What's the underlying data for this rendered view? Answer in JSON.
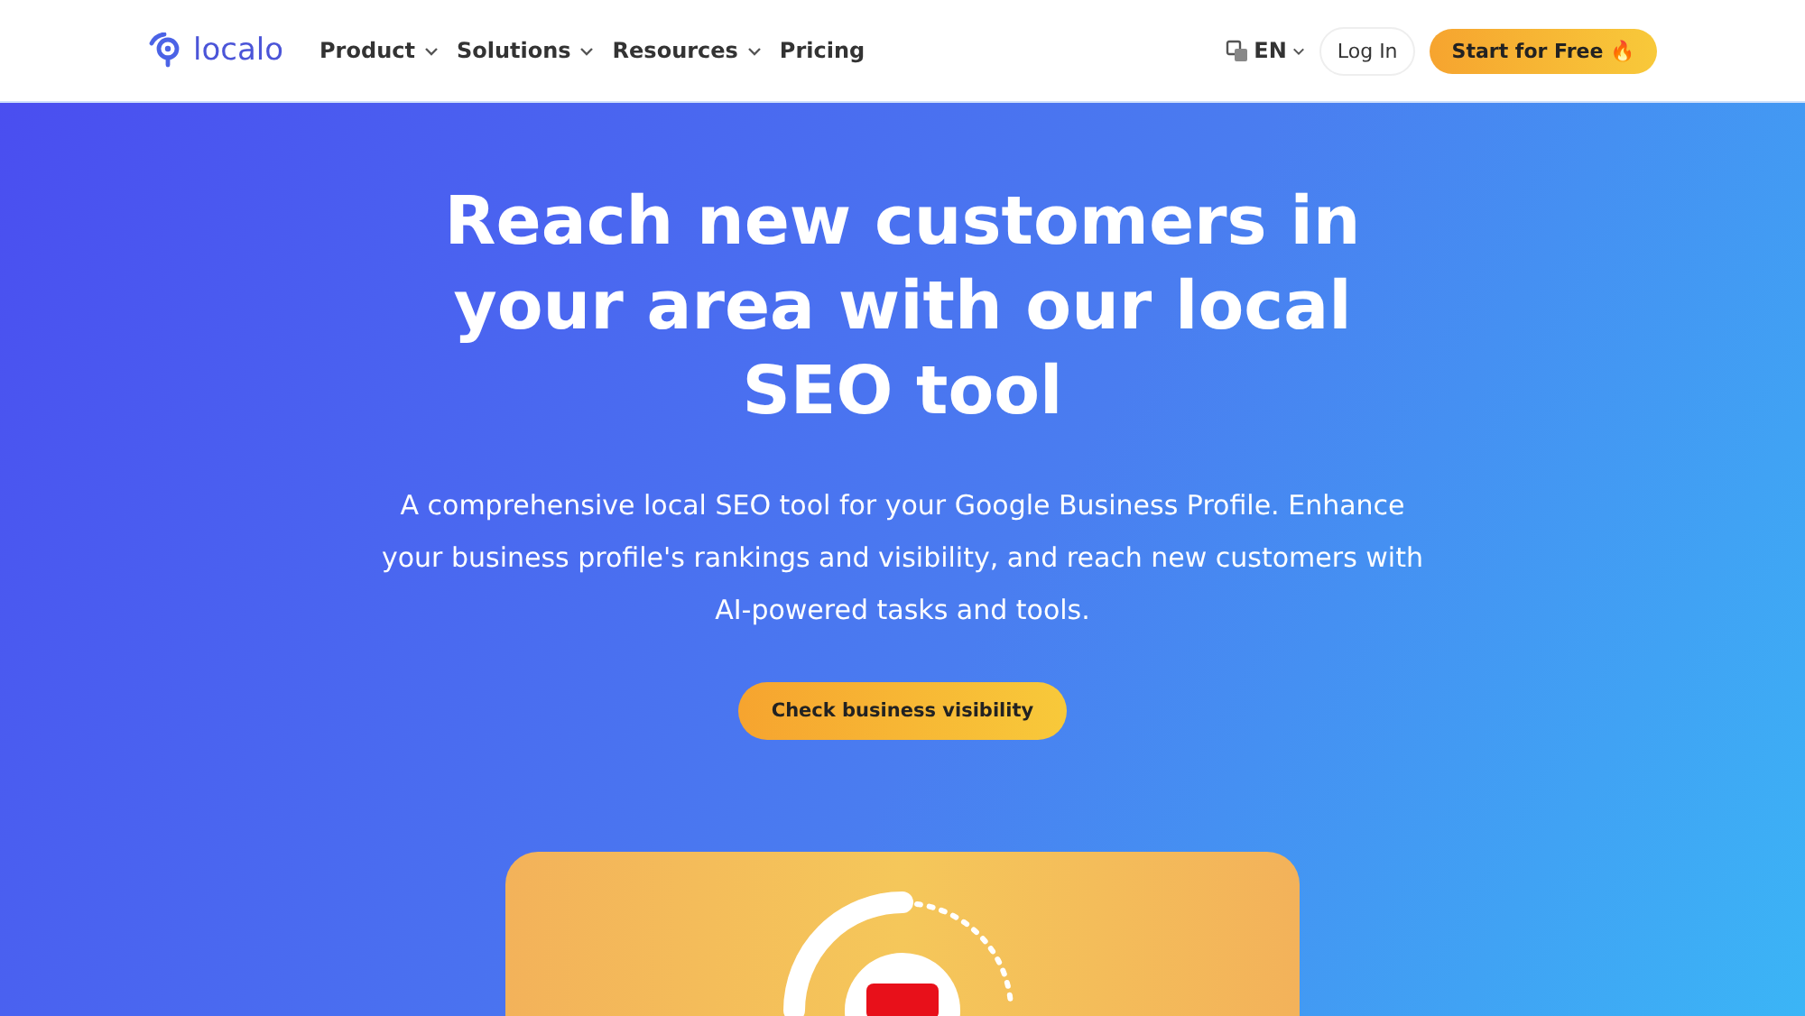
{
  "header": {
    "logo": "localo",
    "nav": [
      {
        "label": "Product",
        "dropdown": true
      },
      {
        "label": "Solutions",
        "dropdown": true
      },
      {
        "label": "Resources",
        "dropdown": true
      },
      {
        "label": "Pricing",
        "dropdown": false
      }
    ],
    "language": "EN",
    "login": "Log In",
    "cta": "Start for Free 🔥"
  },
  "hero": {
    "title": "Reach new customers in your area with our local SEO tool",
    "subtitle": "A comprehensive local SEO tool for your Google Business Profile. Enhance your business profile's rankings and visibility, and reach new customers with AI-powered tasks and tools.",
    "button": "Check business visibility"
  }
}
